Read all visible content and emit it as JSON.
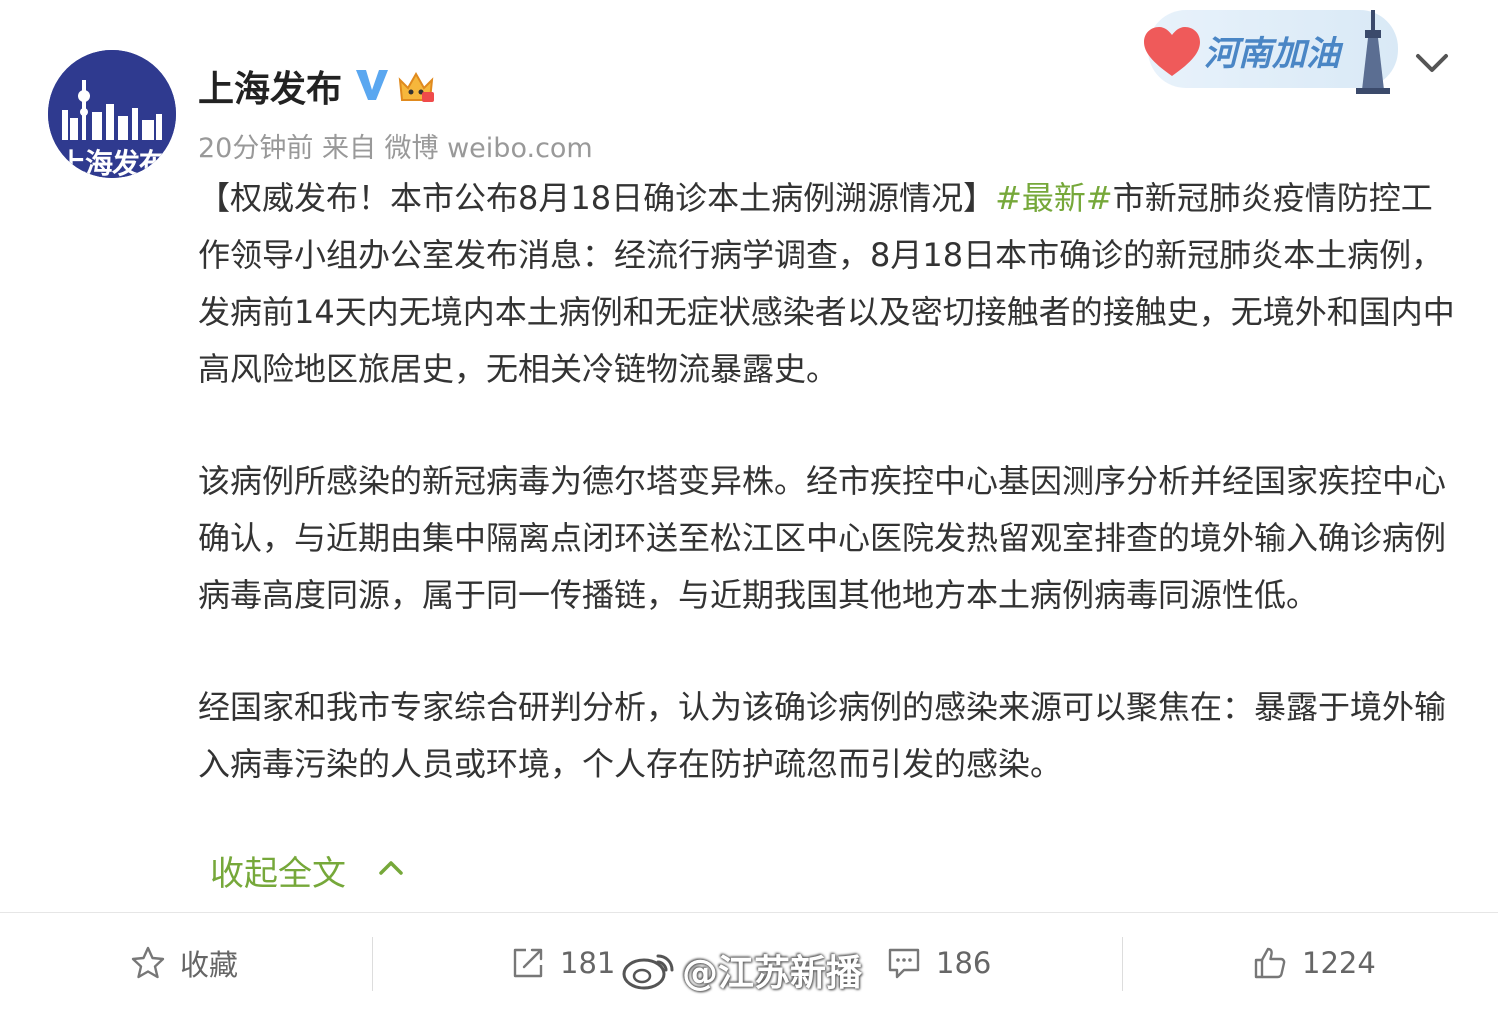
{
  "post": {
    "author": "上海发布",
    "avatar_text": "上海发布",
    "meta": "20分钟前 来自 微博 weibo.com",
    "badge_text": "河南加油",
    "paragraphs": [
      {
        "segments": [
          {
            "text": "【权威发布！本市公布8月18日确诊本土病例溯源情况】",
            "type": "text"
          },
          {
            "text": "#最新#",
            "type": "hashtag"
          },
          {
            "text": "市新冠肺炎疫情防控工作领导小组办公室发布消息：经流行病学调查，8月18日本市确诊的新冠肺炎本土病例，发病前14天内无境内本土病例和无症状感染者以及密切接触者的接触史，无境外和国内中高风险地区旅居史，无相关冷链物流暴露史。",
            "type": "text"
          }
        ]
      },
      {
        "segments": [
          {
            "text": "该病例所感染的新冠病毒为德尔塔变异株。经市疾控中心基因测序分析并经国家疾控中心确认，与近期由集中隔离点闭环送至松江区中心医院发热留观室排查的境外输入确诊病例病毒高度同源，属于同一传播链，与近期我国其他地方本土病例病毒同源性低。",
            "type": "text"
          }
        ]
      },
      {
        "segments": [
          {
            "text": "经国家和我市专家综合研判分析，认为该确诊病例的感染来源可以聚焦在：暴露于境外输入病毒污染的人员或环境，个人存在防护疏忽而引发的感染。",
            "type": "text"
          }
        ]
      }
    ],
    "collapse_label": "收起全文"
  },
  "actions": {
    "favorite_label": "收藏",
    "repost_count": "181",
    "comment_count": "186",
    "like_count": "1224"
  },
  "watermark": "@江苏新播",
  "colors": {
    "hashtag": "#76a83a",
    "meta": "#999999",
    "avatar_bg": "#2f3a8f",
    "verified": "#5aa7f0"
  },
  "icons": {
    "verified": "verified-v-icon",
    "vip": "vip-crown-icon",
    "expand": "chevron-down-icon",
    "collapse": "chevron-up-icon",
    "favorite": "star-icon",
    "repost": "share-icon",
    "comment": "comment-icon",
    "like": "thumbs-up-icon"
  }
}
